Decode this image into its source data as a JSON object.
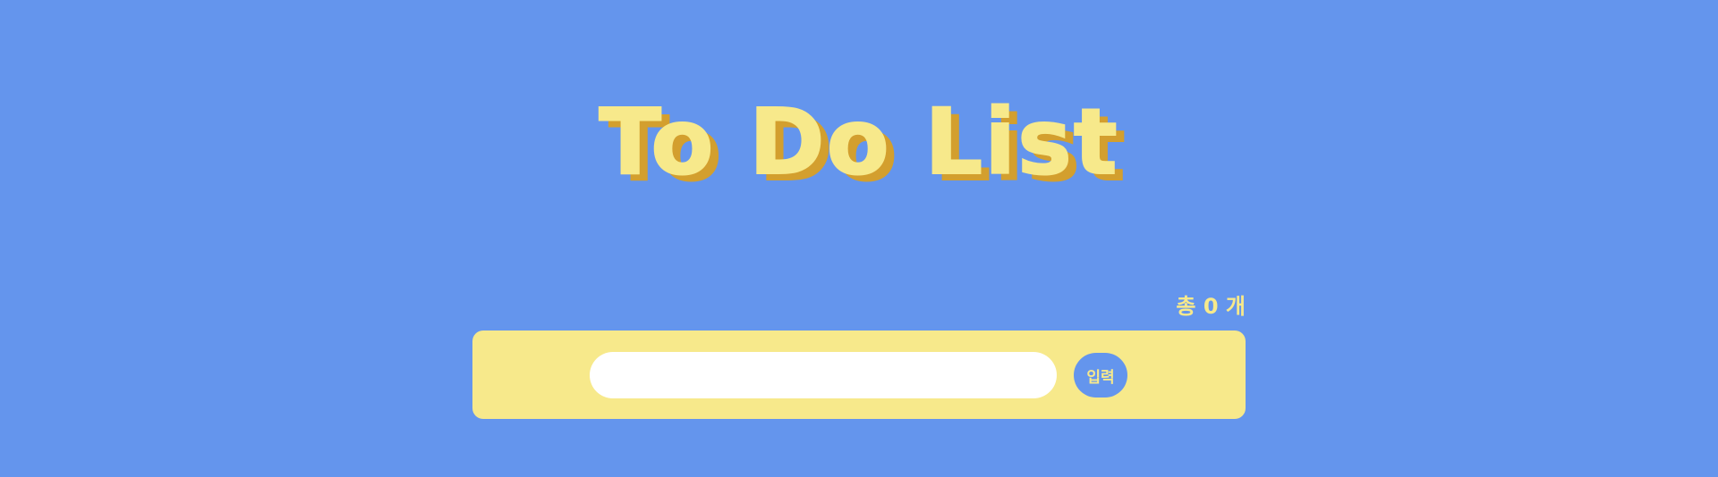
{
  "header": {
    "title": "To Do List"
  },
  "counter": {
    "prefix": "총",
    "value": "0",
    "suffix": "개"
  },
  "form": {
    "input_value": "",
    "input_placeholder": "",
    "submit_label": "입력"
  },
  "colors": {
    "background": "#6495ed",
    "accent": "#f7e98b",
    "title_shadow": "#d39f2e",
    "input_bg": "#ffffff"
  }
}
